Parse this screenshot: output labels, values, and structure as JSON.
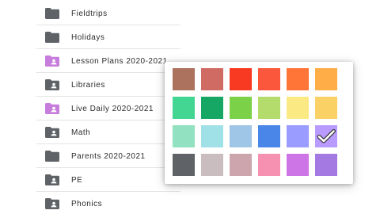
{
  "folders": [
    {
      "name": "Fieldtrips",
      "icon": "folder-icon",
      "color": "#5f6368"
    },
    {
      "name": "Holidays",
      "icon": "folder-icon",
      "color": "#5f6368"
    },
    {
      "name": "Lesson Plans 2020-2021",
      "icon": "shared-folder-icon",
      "color": "#c77ddb"
    },
    {
      "name": "Libraries",
      "icon": "shared-folder-icon",
      "color": "#5f6368"
    },
    {
      "name": "Live Daily 2020-2021",
      "icon": "shared-folder-icon",
      "color": "#c77ddb"
    },
    {
      "name": "Math",
      "icon": "shared-folder-icon",
      "color": "#5f6368"
    },
    {
      "name": "Parents 2020-2021",
      "icon": "folder-icon",
      "color": "#5f6368"
    },
    {
      "name": "PE",
      "icon": "shared-folder-icon",
      "color": "#5f6368"
    },
    {
      "name": "Phonics",
      "icon": "shared-folder-icon",
      "color": "#5f6368"
    }
  ],
  "color_picker": {
    "selected_color": "#b99aff",
    "check_icon": "checkmark-icon",
    "swatches": [
      "#ac725e",
      "#d06b64",
      "#f83a22",
      "#fa573c",
      "#ff7537",
      "#ffad46",
      "#42d692",
      "#16a765",
      "#7bd148",
      "#b3dc6c",
      "#fbe983",
      "#fad165",
      "#92e1c0",
      "#9fe1e7",
      "#9fc6e7",
      "#4986e7",
      "#9a9cff",
      "#b99aff",
      "#5f6368",
      "#cabdbf",
      "#cca6ac",
      "#f691b2",
      "#cd74e6",
      "#a47ae2"
    ]
  }
}
